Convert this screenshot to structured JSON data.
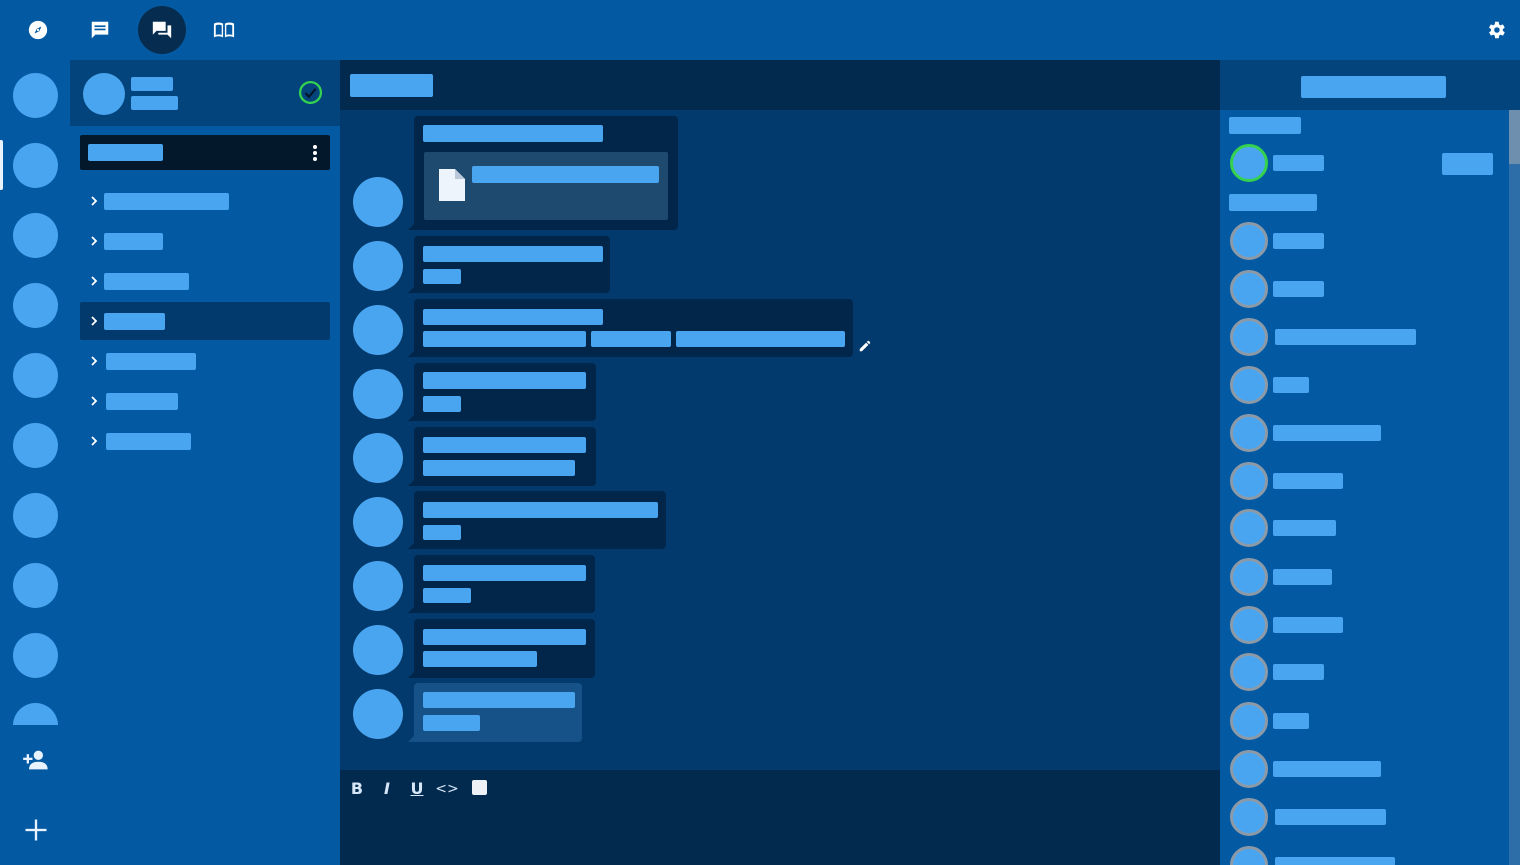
{
  "top_nav": {
    "items": [
      {
        "icon": "compass-icon",
        "active": false
      },
      {
        "icon": "message-icon",
        "active": false
      },
      {
        "icon": "chat-bubbles-icon",
        "active": true
      },
      {
        "icon": "book-icon",
        "active": false
      }
    ],
    "settings_icon": "gear-icon"
  },
  "server_rail": {
    "server_count": 10,
    "add_friend_icon": "add-friend-icon",
    "add_server_icon": "plus-icon"
  },
  "user_panel": {
    "status": "online",
    "status_icon": "check-circle-icon"
  },
  "server_bar": {
    "menu_icon": "kebab-menu-icon"
  },
  "channels": {
    "count": 7,
    "active_index": 3
  },
  "chat": {
    "edit_icon": "pencil-icon",
    "attachment_icon": "file-icon"
  },
  "composer": {
    "bold": "B",
    "italic": "I",
    "underline": "U",
    "code": "<>"
  },
  "members": {
    "scrollbar_position": 0
  },
  "colors": {
    "background": "#0459a3",
    "chat_background": "#033a6d",
    "bubble": "#02264a",
    "placeholder": "#4aa5f0",
    "online": "#35d24f",
    "offline": "#8c9aa8"
  }
}
